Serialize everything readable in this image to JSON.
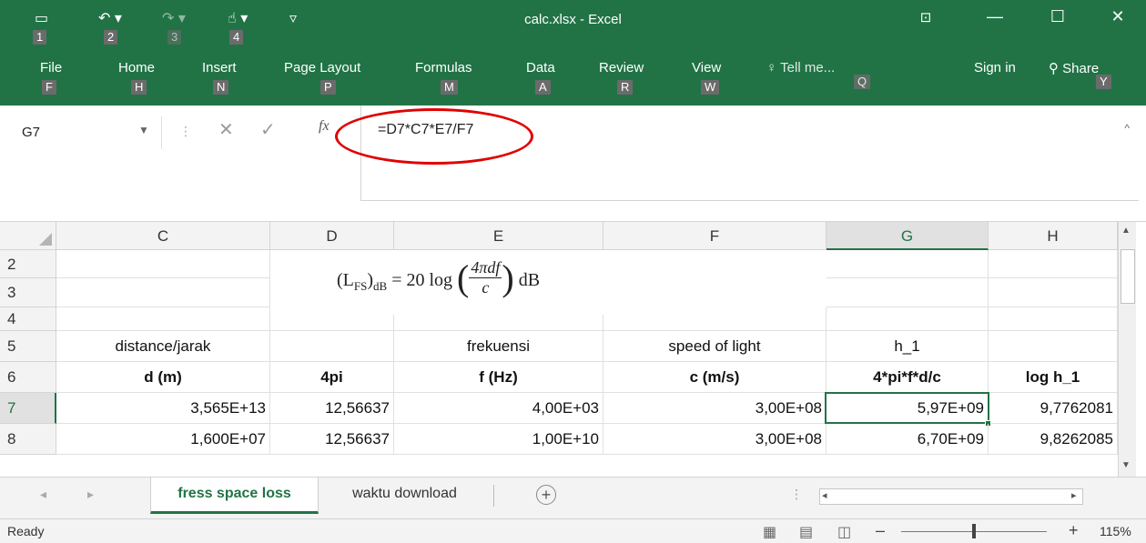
{
  "window": {
    "title": "calc.xlsx - Excel",
    "minimize": "—",
    "maximize": "☐",
    "close": "✕",
    "ribbon_display": "⊡"
  },
  "quick_access": {
    "save_keytip": "1",
    "undo_keytip": "2",
    "redo_keytip": "3",
    "touch_keytip": "4"
  },
  "ribbon_tabs": [
    {
      "label": "File",
      "keytip": "F"
    },
    {
      "label": "Home",
      "keytip": "H"
    },
    {
      "label": "Insert",
      "keytip": "N"
    },
    {
      "label": "Page Layout",
      "keytip": "P"
    },
    {
      "label": "Formulas",
      "keytip": "M"
    },
    {
      "label": "Data",
      "keytip": "A"
    },
    {
      "label": "Review",
      "keytip": "R"
    },
    {
      "label": "View",
      "keytip": "W"
    }
  ],
  "tell_me": {
    "label": "Tell me...",
    "keytip": "Q"
  },
  "sign_in": "Sign in",
  "share": {
    "label": "Share",
    "keytip": "Y"
  },
  "formula_bar": {
    "name_box": "G7",
    "fx": "fx",
    "formula": "=D7*C7*E7/F7"
  },
  "columns": [
    "C",
    "D",
    "E",
    "F",
    "G",
    "H"
  ],
  "rows": [
    "2",
    "3",
    "4",
    "5",
    "6",
    "7",
    "8"
  ],
  "cells": {
    "r5": {
      "C": "distance/jarak",
      "E": "frekuensi",
      "F": "speed of light",
      "G": "h_1"
    },
    "r6": {
      "C": "d (m)",
      "D": "4pi",
      "E": "f (Hz)",
      "F": "c  (m/s)",
      "G": "4*pi*f*d/c",
      "H": "log h_1"
    },
    "r7": {
      "C": "3,565E+13",
      "D": "12,56637",
      "E": "4,00E+03",
      "F": "3,00E+08",
      "G": "5,97E+09",
      "H": "9,7762081"
    },
    "r8": {
      "C": "1,600E+07",
      "D": "12,56637",
      "E": "1,00E+10",
      "F": "3,00E+08",
      "G": "6,70E+09",
      "H": "9,8262085"
    }
  },
  "equation": {
    "lhs": "(L",
    "sub": "FS",
    "rp": ")",
    "db_sub": "dB",
    "equals": " = 20 log",
    "num": "4πdf",
    "den": "c",
    "unit": "dB"
  },
  "sheets": [
    "fress space loss",
    "waktu download"
  ],
  "status": {
    "ready": "Ready",
    "zoom": "115%"
  }
}
